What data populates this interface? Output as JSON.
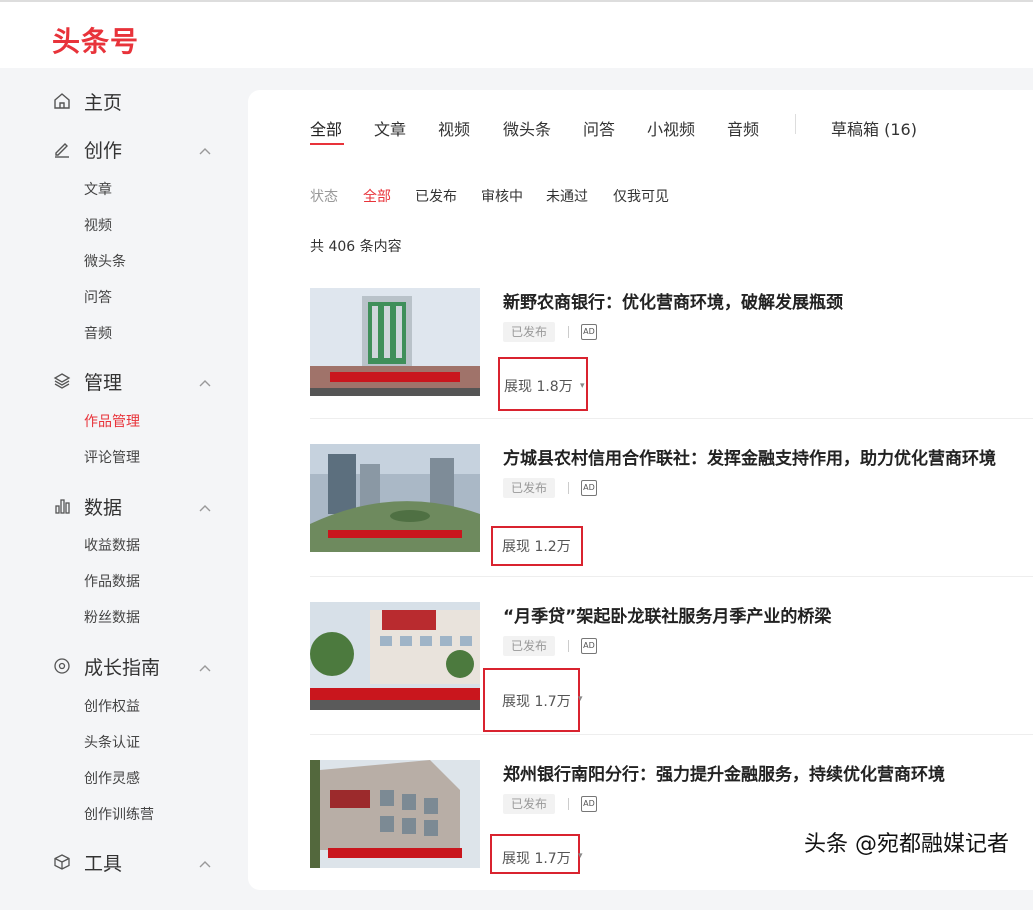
{
  "logo": "头条号",
  "sidebar": {
    "home": "主页",
    "create": {
      "label": "创作",
      "items": [
        "文章",
        "视频",
        "微头条",
        "问答",
        "音频"
      ]
    },
    "manage": {
      "label": "管理",
      "items": [
        "作品管理",
        "评论管理"
      ]
    },
    "data": {
      "label": "数据",
      "items": [
        "收益数据",
        "作品数据",
        "粉丝数据"
      ]
    },
    "growth": {
      "label": "成长指南",
      "items": [
        "创作权益",
        "头条认证",
        "创作灵感",
        "创作训练营"
      ]
    },
    "tools": {
      "label": "工具"
    }
  },
  "tabs": [
    "全部",
    "文章",
    "视频",
    "微头条",
    "问答",
    "小视频",
    "音频"
  ],
  "drafts": "草稿箱 (16)",
  "filters": {
    "label": "状态",
    "items": [
      "全部",
      "已发布",
      "审核中",
      "未通过",
      "仅我可见"
    ]
  },
  "count": "共 406 条内容",
  "items": [
    {
      "title": "新野农商银行：优化营商环境，破解发展瓶颈",
      "status": "已发布",
      "ad": "AD",
      "views": "展现 1.8万"
    },
    {
      "title": "方城县农村信用合作联社：发挥金融支持作用，助力优化营商环境",
      "status": "已发布",
      "ad": "AD",
      "views": "展现 1.2万"
    },
    {
      "title": "“月季贷”架起卧龙联社服务月季产业的桥梁",
      "status": "已发布",
      "ad": "AD",
      "views": "展现 1.7万"
    },
    {
      "title": "郑州银行南阳分行：强力提升金融服务，持续优化营商环境",
      "status": "已发布",
      "ad": "AD",
      "views": "展现 1.7万"
    }
  ],
  "watermark": "头条 @宛都融媒记者",
  "colors": {
    "accent": "#e8333a",
    "highlight_box": "#d9232f"
  }
}
